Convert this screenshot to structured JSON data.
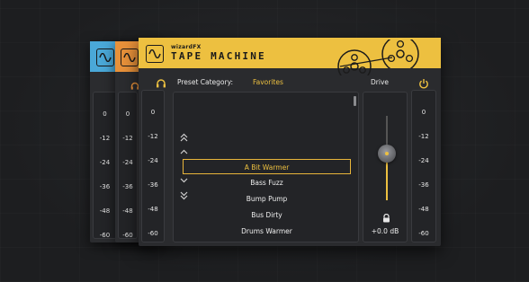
{
  "app": {
    "brand_small": "wizardFX",
    "title": "TAPE MACHINE"
  },
  "colors": {
    "blue": "#4aa8d8",
    "orange": "#e8913a",
    "yellow": "#edc040"
  },
  "meter_scale": [
    "0",
    "-12",
    "-24",
    "-36",
    "-48",
    "-60"
  ],
  "preset": {
    "category_label": "Preset Category:",
    "category_value": "Favorites",
    "items": [
      "A Bit Warmer",
      "Bass Fuzz",
      "Bump Pump",
      "Bus Dirty",
      "Drums Warmer"
    ],
    "selected_index": 0
  },
  "drive": {
    "label": "Drive",
    "value": "+0.0 dB",
    "level": 0.55
  },
  "icons": {
    "headphones": "headphones-icon",
    "power": "power-icon",
    "lock": "lock-icon"
  }
}
